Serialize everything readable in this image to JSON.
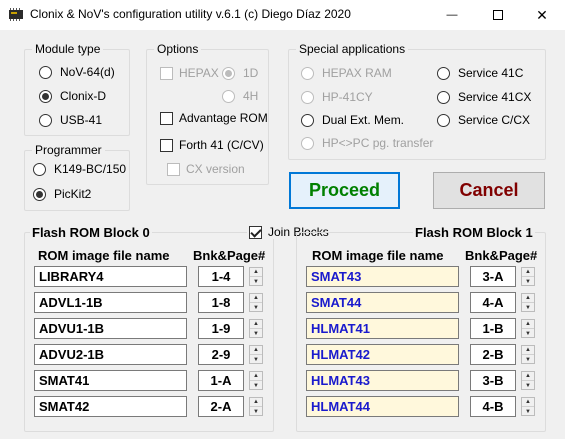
{
  "window": {
    "title": "Clonix & NoV's configuration utility v.6.1       (c) Diego Díaz 2020",
    "minimize_glyph": "—",
    "close_glyph": "✕"
  },
  "module_type": {
    "title": "Module type",
    "options": [
      {
        "label": "NoV-64(d)",
        "checked": false
      },
      {
        "label": "Clonix-D",
        "checked": true
      },
      {
        "label": "USB-41",
        "checked": false
      }
    ]
  },
  "programmer": {
    "title": "Programmer",
    "options": [
      {
        "label": "K149-BC/150",
        "checked": false
      },
      {
        "label": "PicKit2",
        "checked": true
      }
    ]
  },
  "options": {
    "title": "Options",
    "hepax": {
      "label": "HEPAX",
      "checked": false,
      "enabled": false
    },
    "opt_1d": {
      "label": "1D",
      "checked": true,
      "enabled": false
    },
    "opt_4h": {
      "label": "4H",
      "checked": false,
      "enabled": false
    },
    "advantage_rom": {
      "label": "Advantage ROM",
      "checked": false,
      "enabled": true
    },
    "forth41": {
      "label": "Forth 41 (C/CV)",
      "checked": false,
      "enabled": true
    },
    "cx_version": {
      "label": "CX version",
      "checked": false,
      "enabled": false
    }
  },
  "special": {
    "title": "Special applications",
    "left": [
      {
        "label": "HEPAX RAM",
        "checked": false,
        "enabled": false
      },
      {
        "label": "HP-41CY",
        "checked": false,
        "enabled": false
      },
      {
        "label": "Dual Ext. Mem.",
        "checked": false,
        "enabled": true
      },
      {
        "label": "HP<>PC pg. transfer",
        "checked": false,
        "enabled": false
      }
    ],
    "right": [
      {
        "label": "Service 41C",
        "checked": false,
        "enabled": true
      },
      {
        "label": "Service 41CX",
        "checked": false,
        "enabled": true
      },
      {
        "label": "Service C/CX",
        "checked": false,
        "enabled": true
      }
    ]
  },
  "actions": {
    "proceed_label": "Proceed",
    "cancel_label": "Cancel"
  },
  "join_blocks": {
    "label": "Join Blocks",
    "checked": true
  },
  "block0": {
    "title": "Flash ROM Block 0",
    "col_rom": "ROM image file name",
    "col_bnk": "Bnk&Page#",
    "rows": [
      {
        "rom": "LIBRARY4",
        "bnk": "1-4"
      },
      {
        "rom": "ADVL1-1B",
        "bnk": "1-8"
      },
      {
        "rom": "ADVU1-1B",
        "bnk": "1-9"
      },
      {
        "rom": "ADVU2-1B",
        "bnk": "2-9"
      },
      {
        "rom": "SMAT41",
        "bnk": "1-A"
      },
      {
        "rom": "SMAT42",
        "bnk": "2-A"
      }
    ]
  },
  "block1": {
    "title": "Flash ROM Block 1",
    "col_rom": "ROM image file name",
    "col_bnk": "Bnk&Page#",
    "rows": [
      {
        "rom": "SMAT43",
        "bnk": "3-A"
      },
      {
        "rom": "SMAT44",
        "bnk": "4-A"
      },
      {
        "rom": "HLMAT41",
        "bnk": "1-B"
      },
      {
        "rom": "HLMAT42",
        "bnk": "2-B"
      },
      {
        "rom": "HLMAT43",
        "bnk": "3-B"
      },
      {
        "rom": "HLMAT44",
        "bnk": "4-B"
      }
    ]
  }
}
